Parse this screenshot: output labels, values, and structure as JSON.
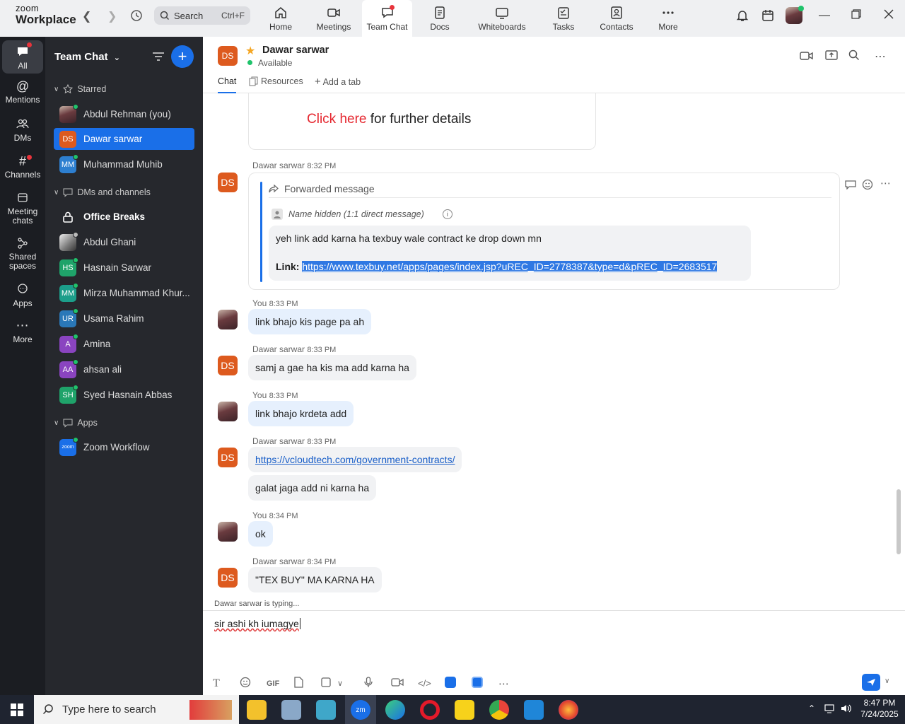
{
  "window": {
    "logo_small": "zoom",
    "logo_big": "Workplace",
    "search_label": "Search",
    "search_shortcut": "Ctrl+F",
    "tabs": [
      {
        "label": "Home",
        "icon": "home-icon"
      },
      {
        "label": "Meetings",
        "icon": "video-icon"
      },
      {
        "label": "Team Chat",
        "icon": "chat-icon"
      },
      {
        "label": "Docs",
        "icon": "doc-icon"
      },
      {
        "label": "Whiteboards",
        "icon": "whiteboard-icon"
      },
      {
        "label": "Tasks",
        "icon": "tasks-icon"
      },
      {
        "label": "Contacts",
        "icon": "contacts-icon"
      },
      {
        "label": "More",
        "icon": "more-icon"
      }
    ]
  },
  "rail": [
    {
      "label": "All"
    },
    {
      "label": "Mentions"
    },
    {
      "label": "DMs"
    },
    {
      "label": "Channels"
    },
    {
      "label": "Meeting chats"
    },
    {
      "label": "Shared spaces"
    },
    {
      "label": "Apps"
    },
    {
      "label": "More"
    }
  ],
  "sidebar": {
    "title": "Team Chat",
    "starred_label": "Starred",
    "starred": [
      {
        "name": "Abdul Rehman (you)",
        "initials": "",
        "color": "#7a4a4f"
      },
      {
        "name": "Dawar sarwar",
        "initials": "DS",
        "color": "#dd5a1e"
      },
      {
        "name": "Muhammad Muhib",
        "initials": "MM",
        "color": "#2d7fd0"
      }
    ],
    "dms_label": "DMs and channels",
    "dms": [
      {
        "name": "Office Breaks",
        "initials": "",
        "color": ""
      },
      {
        "name": "Abdul Ghani",
        "initials": "",
        "color": "#888888"
      },
      {
        "name": "Hasnain Sarwar",
        "initials": "HS",
        "color": "#1fa36a"
      },
      {
        "name": "Mirza Muhammad Khur...",
        "initials": "MM",
        "color": "#1c9e8a"
      },
      {
        "name": "Usama Rahim",
        "initials": "UR",
        "color": "#2a78b8"
      },
      {
        "name": "Amina",
        "initials": "A",
        "color": "#8a44c0"
      },
      {
        "name": "ahsan ali",
        "initials": "AA",
        "color": "#8a44c0"
      },
      {
        "name": "Syed Hasnain Abbas",
        "initials": "SH",
        "color": "#1fa36a"
      }
    ],
    "apps_label": "Apps",
    "apps": [
      {
        "name": "Zoom Workflow",
        "initials": "zoom",
        "color": "#1a6fe8"
      }
    ]
  },
  "chat": {
    "contact_initials": "DS",
    "contact_name": "Dawar sarwar",
    "status": "Available",
    "tabs": [
      "Chat",
      "Resources",
      "Add a tab"
    ],
    "card_link": "Click here",
    "card_text": " for further details",
    "fwd_sender": "Dawar sarwar",
    "fwd_time": "8:32 PM",
    "fwd_label": "Forwarded message",
    "fwd_origin": "Name hidden (1:1 direct message)",
    "fwd_text": "yeh link add karna ha texbuy wale contract ke drop down mn",
    "fwd_link_label": "Link:",
    "fwd_link": "https://www.texbuy.net/apps/pages/index.jsp?uREC_ID=2778387&type=d&pREC_ID=2683517",
    "messages": [
      {
        "sender": "You",
        "time": "8:33 PM",
        "text": "link bhajo kis page pa ah",
        "me": true
      },
      {
        "sender": "Dawar sarwar",
        "time": "8:33 PM",
        "text": "samj a gae ha kis ma add karna ha",
        "me": false
      },
      {
        "sender": "You",
        "time": "8:33 PM",
        "text": "link bhajo krdeta add",
        "me": true
      },
      {
        "sender": "Dawar sarwar",
        "time": "8:33 PM",
        "text": "https://vcloudtech.com/government-contracts/",
        "text2": "galat jaga add ni karna ha",
        "me": false
      },
      {
        "sender": "You",
        "time": "8:34 PM",
        "text": "ok",
        "me": true
      },
      {
        "sender": "Dawar sarwar",
        "time": "8:34 PM",
        "text": "\"TEX BUY\" MA KARNA HA",
        "me": false
      }
    ],
    "typing": "Dawar sarwar  is typing...",
    "draft": "sir ashi kh iumagye",
    "toolbar": [
      "GIF"
    ]
  },
  "taskbar": {
    "search_placeholder": "Type here to search",
    "time": "8:47 PM",
    "date": "7/24/2025"
  }
}
